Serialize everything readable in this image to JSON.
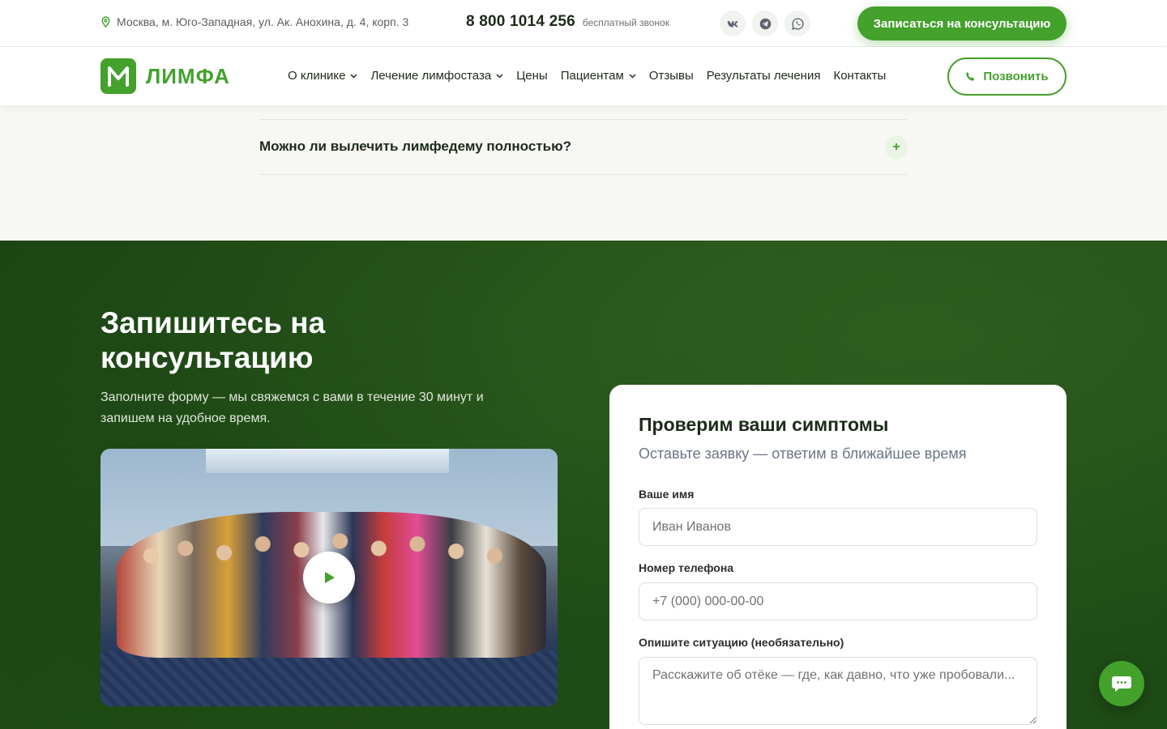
{
  "topbar": {
    "address": "Москва, м. Юго-Западная, ул. Ак. Анохина, д. 4, корп. 3",
    "phone": "8 800 1014 256",
    "phone_note": "бесплатный звонок",
    "socials": [
      "vk-icon",
      "telegram-icon",
      "whatsapp-icon"
    ],
    "cta_label": "Записаться на консультацию"
  },
  "header": {
    "logo_text": "ЛИМФА",
    "nav": [
      {
        "label": "О клинике",
        "dropdown": true
      },
      {
        "label": "Лечение лимфостаза",
        "dropdown": true
      },
      {
        "label": "Цены",
        "dropdown": false
      },
      {
        "label": "Пациентам",
        "dropdown": true
      },
      {
        "label": "Отзывы",
        "dropdown": false
      },
      {
        "label": "Результаты лечения",
        "dropdown": false
      },
      {
        "label": "Контакты",
        "dropdown": false
      }
    ],
    "call_label": "Позвонить"
  },
  "faq": {
    "question": "Можно ли вылечить лимфедему полностью?",
    "toggle": "+"
  },
  "consult": {
    "title": "Запишитесь на консультацию",
    "subtitle": "Заполните форму — мы свяжемся с вами в течение 30 минут и запишем на удобное время."
  },
  "form": {
    "title": "Проверим ваши симптомы",
    "subtitle": "Оставьте заявку — ответим в ближайшее время",
    "name_label": "Ваше имя",
    "name_placeholder": "Иван Иванов",
    "phone_label": "Номер телефона",
    "phone_placeholder": "+7 (000) 000-00-00",
    "situation_label": "Опишите ситуацию (необязательно)",
    "situation_placeholder": "Расскажите об отёке — где, как давно, что уже пробовали..."
  },
  "colors": {
    "accent": "#43a12c",
    "dark_green": "#1f4a16",
    "page_bg": "#f7f7f3"
  }
}
